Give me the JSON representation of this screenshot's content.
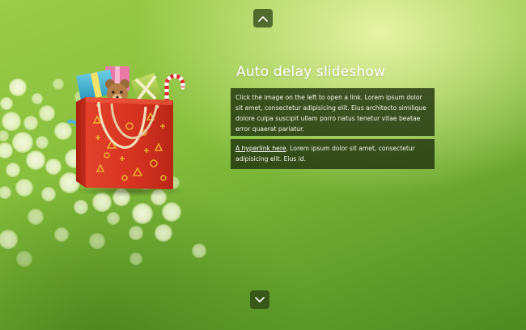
{
  "slide": {
    "title": "Auto delay slideshow",
    "paragraph_1": "Click the image on the left to open a link. Lorem ipsum dolor sit amet, consectetur adipisicing elit. Eius architecto similique dolore culpa suscipit ullam porro natus tenetur vitae beatae error quaerat pariatur.",
    "hyperlink_label": "A hyperlink here",
    "paragraph_2_rest": ". Lorem ipsum dolor sit amet, consectetur adipisicing elit. Eius id."
  },
  "navigation": {
    "up_icon": "chevron-up-icon",
    "down_icon": "chevron-down-icon"
  },
  "image": {
    "subject": "gift-bag-icon"
  },
  "colors": {
    "background_light": "#ecf6aa",
    "background_mid": "#86be3c",
    "background_dark": "#4f8a22",
    "panel": "#1e300e",
    "text": "#f3f6ea",
    "bag_red": "#d8321e",
    "bag_pattern": "#f0b830"
  }
}
